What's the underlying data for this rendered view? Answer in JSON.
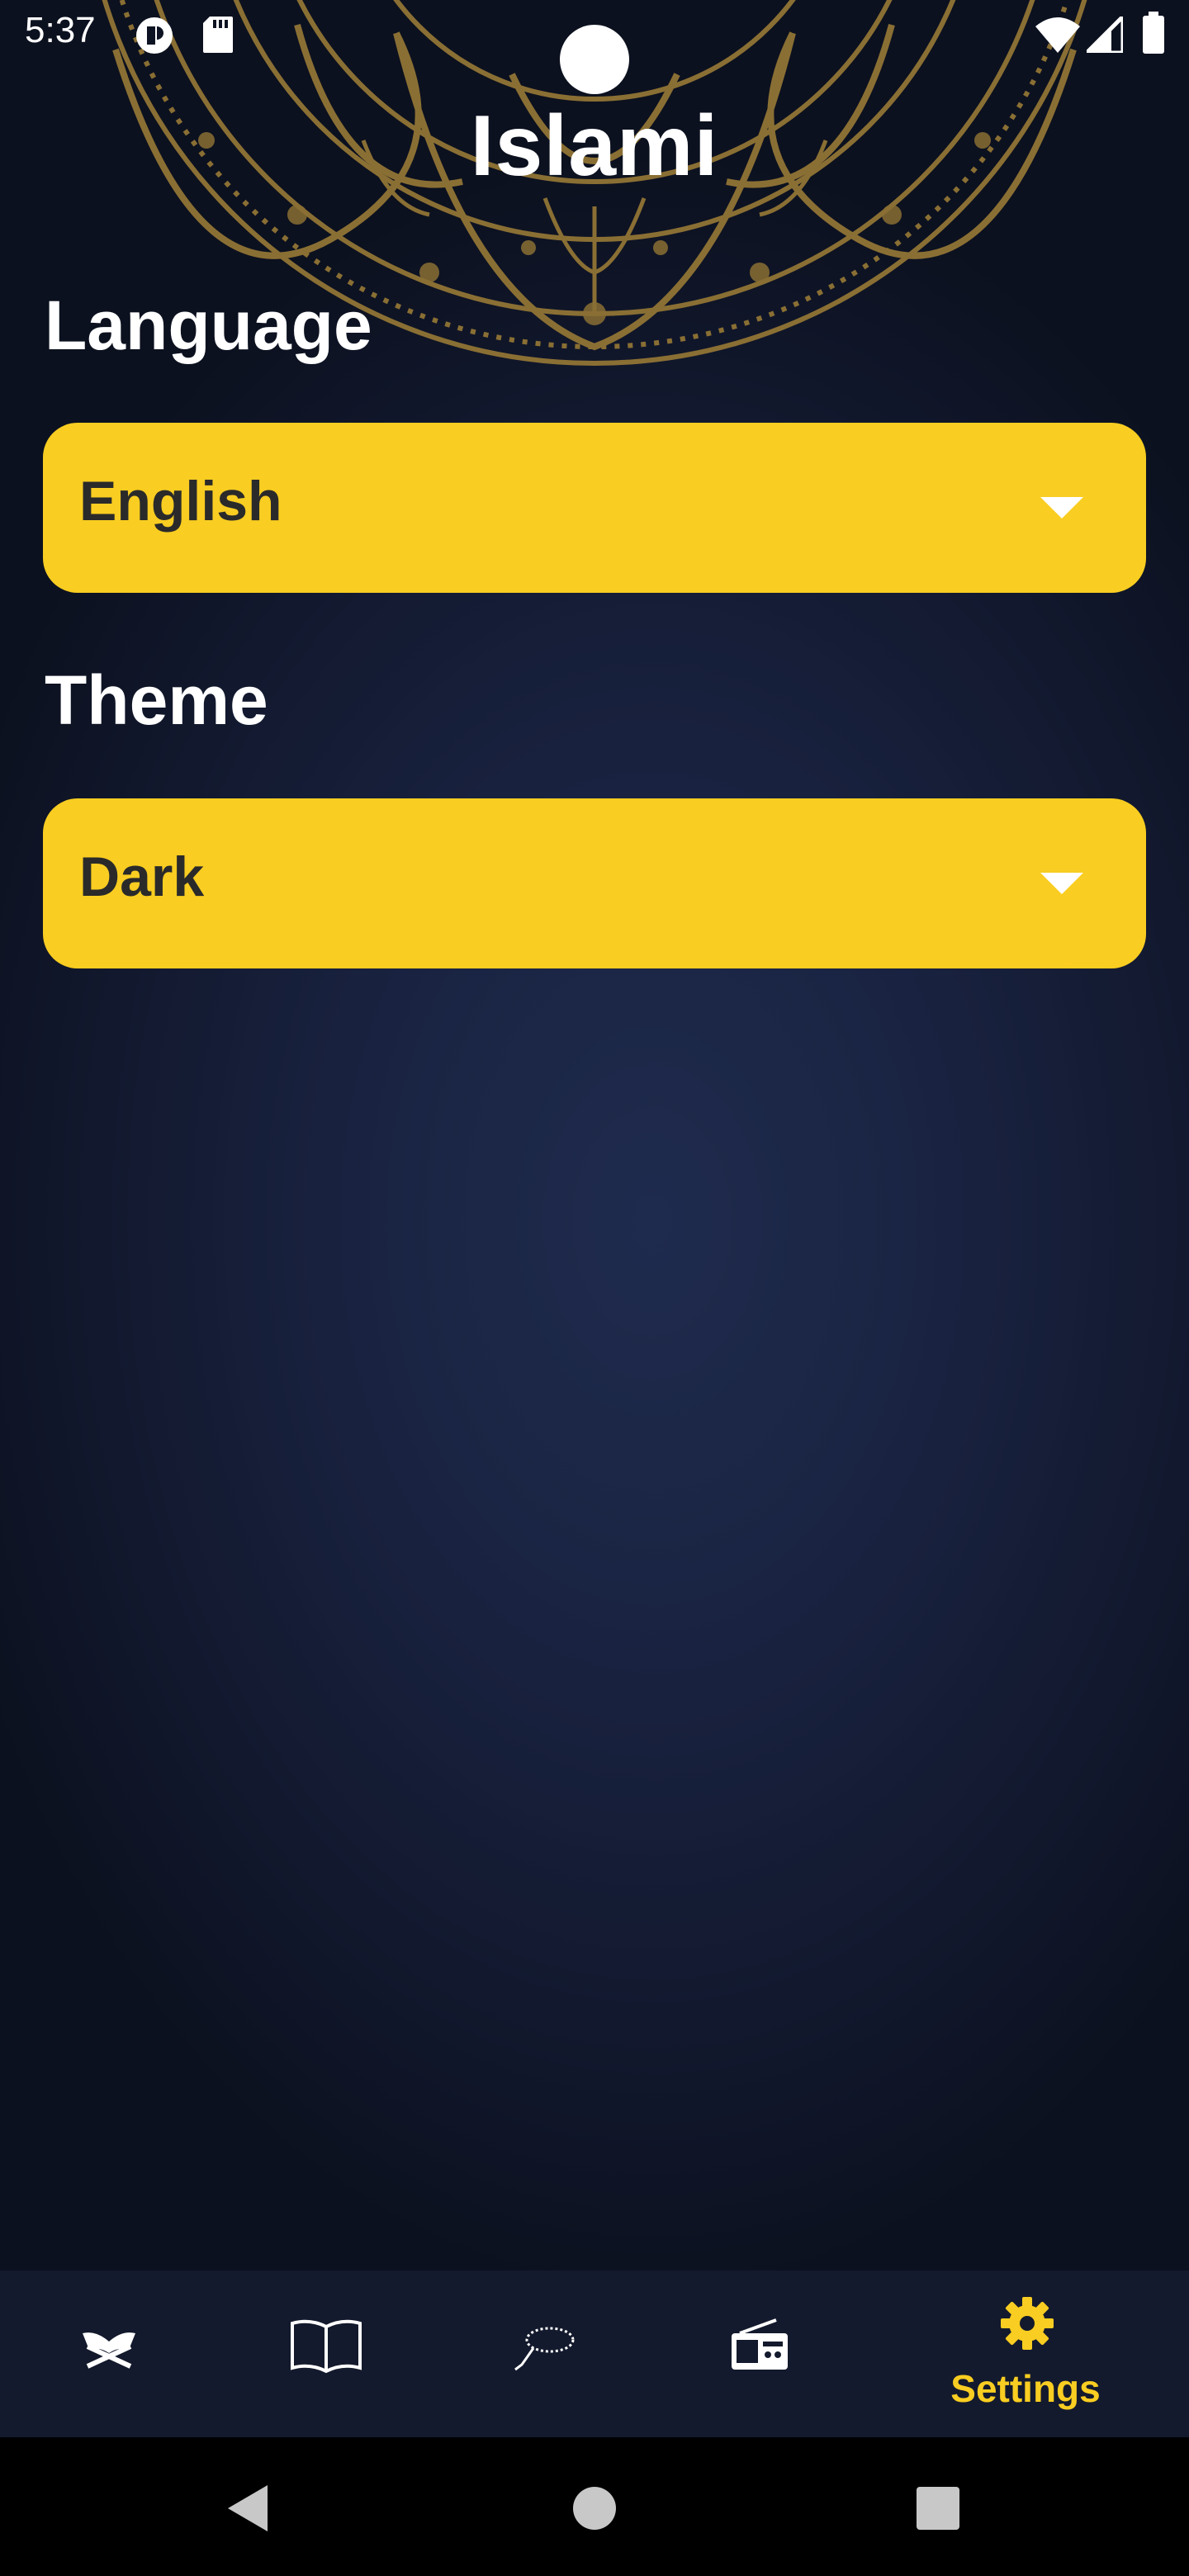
{
  "status_bar": {
    "time": "5:37",
    "icons": [
      "shield-notification-icon",
      "sd-card-icon",
      "wifi-icon",
      "signal-icon",
      "battery-icon"
    ]
  },
  "app": {
    "title": "Islami"
  },
  "settings": {
    "language_label": "Language",
    "language_value": "English",
    "theme_label": "Theme",
    "theme_value": "Dark"
  },
  "bottom_nav": {
    "items": [
      {
        "name": "quran",
        "icon": "quran-stand-icon",
        "label": ""
      },
      {
        "name": "hadith",
        "icon": "open-book-icon",
        "label": ""
      },
      {
        "name": "sebha",
        "icon": "prayer-beads-icon",
        "label": ""
      },
      {
        "name": "radio",
        "icon": "radio-icon",
        "label": ""
      },
      {
        "name": "settings",
        "icon": "gear-icon",
        "label": "Settings",
        "selected": true
      }
    ]
  },
  "system_nav": {
    "buttons": [
      "back-icon",
      "home-icon",
      "recents-icon"
    ]
  },
  "colors": {
    "accent": "#f9cd21",
    "background": "#1a2443",
    "nav_background": "#141a2d",
    "mandala": "#8a6f34"
  }
}
